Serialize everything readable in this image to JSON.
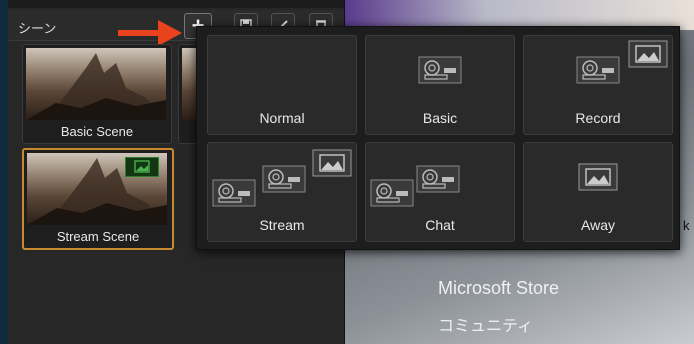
{
  "scenes_panel": {
    "title": "シーン",
    "add_icon": "plus-icon",
    "toolbar_icons": [
      "save-icon",
      "edit-icon",
      "delete-icon"
    ],
    "scenes": [
      {
        "label": "Basic Scene",
        "selected": false
      },
      {
        "label": "Stream Scene",
        "selected": true
      }
    ],
    "arrow_color": "#e8431c",
    "selected_border_color": "#c88a2e"
  },
  "template_popup": {
    "templates": [
      {
        "label": "Normal",
        "icons": []
      },
      {
        "label": "Basic",
        "icons": [
          "webcam-icon"
        ]
      },
      {
        "label": "Record",
        "icons": [
          "webcam-icon",
          "image-icon"
        ]
      },
      {
        "label": "Stream",
        "icons": [
          "webcam-icon",
          "webcam-icon",
          "image-icon"
        ]
      },
      {
        "label": "Chat",
        "icons": [
          "webcam-icon",
          "webcam-icon"
        ]
      },
      {
        "label": "Away",
        "icons": [
          "image-icon"
        ]
      }
    ]
  },
  "desktop": {
    "store_title": "Microsoft Store",
    "store_subtitle": "コミュニティ",
    "edge_text": "k"
  }
}
